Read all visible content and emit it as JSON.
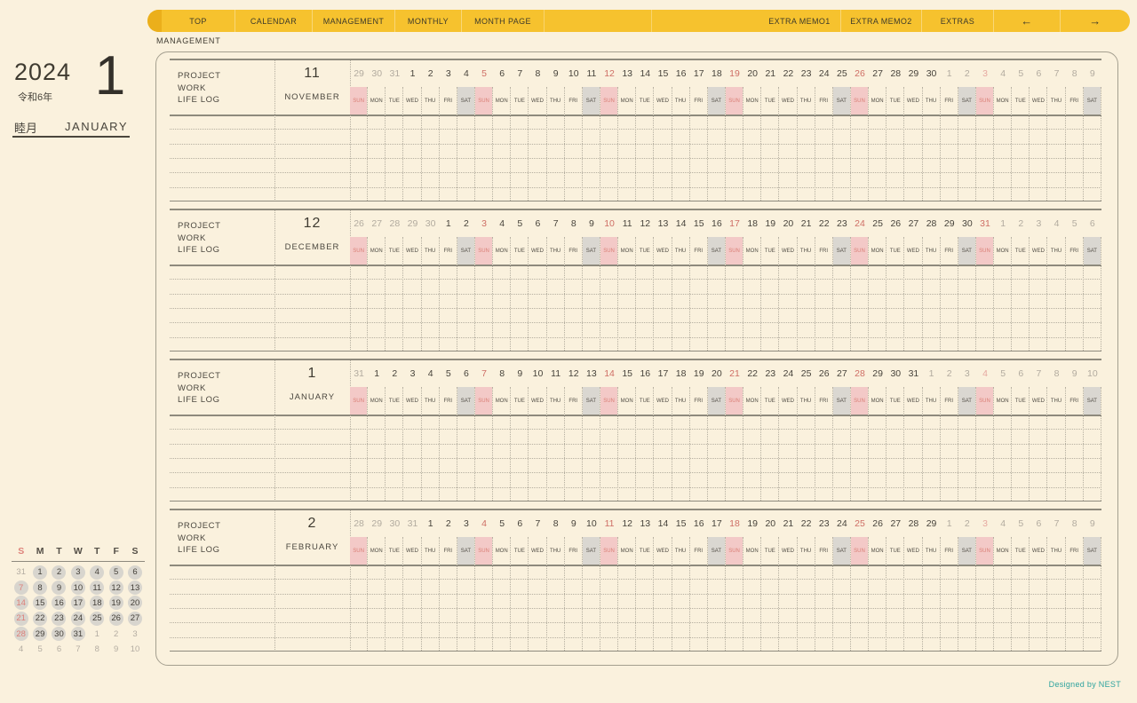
{
  "page": {
    "year": "2024",
    "era": "令和6年",
    "month_number_big": "1",
    "month_jp": "睦月",
    "month_en": "JANUARY",
    "breadcrumb": "MANAGEMENT",
    "credit": "Designed by NEST"
  },
  "nav": {
    "tabs_left": [
      "TOP",
      "CALENDAR",
      "MANAGEMENT",
      "MONTHLY",
      "MONTH PAGE"
    ],
    "tabs_right": [
      "EXTRA MEMO1",
      "EXTRA MEMO2",
      "EXTRAS"
    ],
    "arrow_prev": "←",
    "arrow_next": "→"
  },
  "labels": {
    "row_labels": [
      "PROJECT",
      "WORK",
      "LIFE LOG"
    ],
    "dow": [
      "SUN",
      "MON",
      "TUE",
      "WED",
      "THU",
      "FRI",
      "SAT"
    ]
  },
  "day_types": {
    "d": "current-month",
    "o": "other-month",
    "r": "current-month-sunday-red",
    "p": "other-month-sunday-salmon"
  },
  "months": [
    {
      "num": "11",
      "name": "NOVEMBER",
      "days": [
        [
          "29",
          "o"
        ],
        [
          "30",
          "o"
        ],
        [
          "31",
          "o"
        ],
        [
          "1",
          "d"
        ],
        [
          "2",
          "d"
        ],
        [
          "3",
          "d"
        ],
        [
          "4",
          "d"
        ],
        [
          "5",
          "r"
        ],
        [
          "6",
          "d"
        ],
        [
          "7",
          "d"
        ],
        [
          "8",
          "d"
        ],
        [
          "9",
          "d"
        ],
        [
          "10",
          "d"
        ],
        [
          "11",
          "d"
        ],
        [
          "12",
          "r"
        ],
        [
          "13",
          "d"
        ],
        [
          "14",
          "d"
        ],
        [
          "15",
          "d"
        ],
        [
          "16",
          "d"
        ],
        [
          "17",
          "d"
        ],
        [
          "18",
          "d"
        ],
        [
          "19",
          "r"
        ],
        [
          "20",
          "d"
        ],
        [
          "21",
          "d"
        ],
        [
          "22",
          "d"
        ],
        [
          "23",
          "d"
        ],
        [
          "24",
          "d"
        ],
        [
          "25",
          "d"
        ],
        [
          "26",
          "r"
        ],
        [
          "27",
          "d"
        ],
        [
          "28",
          "d"
        ],
        [
          "29",
          "d"
        ],
        [
          "30",
          "d"
        ],
        [
          "1",
          "o"
        ],
        [
          "2",
          "o"
        ],
        [
          "3",
          "p"
        ],
        [
          "4",
          "o"
        ],
        [
          "5",
          "o"
        ],
        [
          "6",
          "o"
        ],
        [
          "7",
          "o"
        ],
        [
          "8",
          "o"
        ],
        [
          "9",
          "o"
        ]
      ]
    },
    {
      "num": "12",
      "name": "DECEMBER",
      "days": [
        [
          "26",
          "o"
        ],
        [
          "27",
          "o"
        ],
        [
          "28",
          "o"
        ],
        [
          "29",
          "o"
        ],
        [
          "30",
          "o"
        ],
        [
          "1",
          "d"
        ],
        [
          "2",
          "d"
        ],
        [
          "3",
          "r"
        ],
        [
          "4",
          "d"
        ],
        [
          "5",
          "d"
        ],
        [
          "6",
          "d"
        ],
        [
          "7",
          "d"
        ],
        [
          "8",
          "d"
        ],
        [
          "9",
          "d"
        ],
        [
          "10",
          "r"
        ],
        [
          "11",
          "d"
        ],
        [
          "12",
          "d"
        ],
        [
          "13",
          "d"
        ],
        [
          "14",
          "d"
        ],
        [
          "15",
          "d"
        ],
        [
          "16",
          "d"
        ],
        [
          "17",
          "r"
        ],
        [
          "18",
          "d"
        ],
        [
          "19",
          "d"
        ],
        [
          "20",
          "d"
        ],
        [
          "21",
          "d"
        ],
        [
          "22",
          "d"
        ],
        [
          "23",
          "d"
        ],
        [
          "24",
          "r"
        ],
        [
          "25",
          "d"
        ],
        [
          "26",
          "d"
        ],
        [
          "27",
          "d"
        ],
        [
          "28",
          "d"
        ],
        [
          "29",
          "d"
        ],
        [
          "30",
          "d"
        ],
        [
          "31",
          "r"
        ],
        [
          "1",
          "o"
        ],
        [
          "2",
          "o"
        ],
        [
          "3",
          "o"
        ],
        [
          "4",
          "o"
        ],
        [
          "5",
          "o"
        ],
        [
          "6",
          "o"
        ]
      ]
    },
    {
      "num": "1",
      "name": "JANUARY",
      "days": [
        [
          "31",
          "o"
        ],
        [
          "1",
          "d"
        ],
        [
          "2",
          "d"
        ],
        [
          "3",
          "d"
        ],
        [
          "4",
          "d"
        ],
        [
          "5",
          "d"
        ],
        [
          "6",
          "d"
        ],
        [
          "7",
          "r"
        ],
        [
          "8",
          "d"
        ],
        [
          "9",
          "d"
        ],
        [
          "10",
          "d"
        ],
        [
          "11",
          "d"
        ],
        [
          "12",
          "d"
        ],
        [
          "13",
          "d"
        ],
        [
          "14",
          "r"
        ],
        [
          "15",
          "d"
        ],
        [
          "16",
          "d"
        ],
        [
          "17",
          "d"
        ],
        [
          "18",
          "d"
        ],
        [
          "19",
          "d"
        ],
        [
          "20",
          "d"
        ],
        [
          "21",
          "r"
        ],
        [
          "22",
          "d"
        ],
        [
          "23",
          "d"
        ],
        [
          "24",
          "d"
        ],
        [
          "25",
          "d"
        ],
        [
          "26",
          "d"
        ],
        [
          "27",
          "d"
        ],
        [
          "28",
          "r"
        ],
        [
          "29",
          "d"
        ],
        [
          "30",
          "d"
        ],
        [
          "31",
          "d"
        ],
        [
          "1",
          "o"
        ],
        [
          "2",
          "o"
        ],
        [
          "3",
          "o"
        ],
        [
          "4",
          "p"
        ],
        [
          "5",
          "o"
        ],
        [
          "6",
          "o"
        ],
        [
          "7",
          "o"
        ],
        [
          "8",
          "o"
        ],
        [
          "9",
          "o"
        ],
        [
          "10",
          "o"
        ]
      ]
    },
    {
      "num": "2",
      "name": "FEBRUARY",
      "days": [
        [
          "28",
          "o"
        ],
        [
          "29",
          "o"
        ],
        [
          "30",
          "o"
        ],
        [
          "31",
          "o"
        ],
        [
          "1",
          "d"
        ],
        [
          "2",
          "d"
        ],
        [
          "3",
          "d"
        ],
        [
          "4",
          "r"
        ],
        [
          "5",
          "d"
        ],
        [
          "6",
          "d"
        ],
        [
          "7",
          "d"
        ],
        [
          "8",
          "d"
        ],
        [
          "9",
          "d"
        ],
        [
          "10",
          "d"
        ],
        [
          "11",
          "r"
        ],
        [
          "12",
          "d"
        ],
        [
          "13",
          "d"
        ],
        [
          "14",
          "d"
        ],
        [
          "15",
          "d"
        ],
        [
          "16",
          "d"
        ],
        [
          "17",
          "d"
        ],
        [
          "18",
          "r"
        ],
        [
          "19",
          "d"
        ],
        [
          "20",
          "d"
        ],
        [
          "21",
          "d"
        ],
        [
          "22",
          "d"
        ],
        [
          "23",
          "d"
        ],
        [
          "24",
          "d"
        ],
        [
          "25",
          "r"
        ],
        [
          "26",
          "d"
        ],
        [
          "27",
          "d"
        ],
        [
          "28",
          "d"
        ],
        [
          "29",
          "d"
        ],
        [
          "1",
          "o"
        ],
        [
          "2",
          "o"
        ],
        [
          "3",
          "p"
        ],
        [
          "4",
          "o"
        ],
        [
          "5",
          "o"
        ],
        [
          "6",
          "o"
        ],
        [
          "7",
          "o"
        ],
        [
          "8",
          "o"
        ],
        [
          "9",
          "o"
        ]
      ]
    }
  ],
  "mini_calendar": {
    "headers": [
      "S",
      "M",
      "T",
      "W",
      "T",
      "F",
      "S"
    ],
    "weeks": [
      [
        [
          "31",
          "o"
        ],
        [
          "1",
          "c"
        ],
        [
          "2",
          "c"
        ],
        [
          "3",
          "c"
        ],
        [
          "4",
          "c"
        ],
        [
          "5",
          "c"
        ],
        [
          "6",
          "c"
        ]
      ],
      [
        [
          "7",
          "s"
        ],
        [
          "8",
          "c"
        ],
        [
          "9",
          "c"
        ],
        [
          "10",
          "c"
        ],
        [
          "11",
          "c"
        ],
        [
          "12",
          "c"
        ],
        [
          "13",
          "c"
        ]
      ],
      [
        [
          "14",
          "s"
        ],
        [
          "15",
          "c"
        ],
        [
          "16",
          "c"
        ],
        [
          "17",
          "c"
        ],
        [
          "18",
          "c"
        ],
        [
          "19",
          "c"
        ],
        [
          "20",
          "c"
        ]
      ],
      [
        [
          "21",
          "s"
        ],
        [
          "22",
          "c"
        ],
        [
          "23",
          "c"
        ],
        [
          "24",
          "c"
        ],
        [
          "25",
          "c"
        ],
        [
          "26",
          "c"
        ],
        [
          "27",
          "c"
        ]
      ],
      [
        [
          "28",
          "s"
        ],
        [
          "29",
          "c"
        ],
        [
          "30",
          "c"
        ],
        [
          "31",
          "c"
        ],
        [
          "1",
          "o"
        ],
        [
          "2",
          "o"
        ],
        [
          "3",
          "o"
        ]
      ],
      [
        [
          "4",
          "o"
        ],
        [
          "5",
          "o"
        ],
        [
          "6",
          "o"
        ],
        [
          "7",
          "o"
        ],
        [
          "8",
          "o"
        ],
        [
          "9",
          "o"
        ],
        [
          "10",
          "o"
        ]
      ]
    ]
  },
  "colors": {
    "background": "#FAF1DD",
    "nav_yellow": "#F6C22E",
    "nav_cap_yellow": "#EBAF1B",
    "sunday_cell_pink": "#F3C9C7",
    "saturday_cell_gray": "#DAD7D1",
    "sunday_red": "#CE6E65",
    "other_month_gray": "#B2AB9F",
    "line_gray": "#8E8A7D",
    "credit_teal": "#2EA39E"
  }
}
